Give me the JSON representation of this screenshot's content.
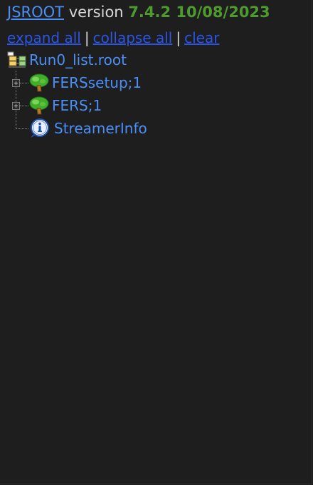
{
  "header": {
    "title_link": "JSROOT",
    "version_word": "version",
    "version_value": "7.4.2 10/08/2023"
  },
  "controls": {
    "expand_all": "expand all",
    "collapse_all": "collapse all",
    "clear": "clear",
    "separator": "|"
  },
  "tree": {
    "root": {
      "label": "Run0_list.root",
      "icon": "root-file-icon"
    },
    "children": [
      {
        "label": "FERSsetup;1",
        "icon": "ttree-icon",
        "expandable": true
      },
      {
        "label": "FERS;1",
        "icon": "ttree-icon",
        "expandable": true
      },
      {
        "label": "StreamerInfo",
        "icon": "info-icon",
        "expandable": false
      }
    ]
  },
  "colors": {
    "background": "#1e1e1e",
    "link": "#4a8ff7",
    "control_link": "#2a55e6",
    "version": "#4e9a2e"
  }
}
